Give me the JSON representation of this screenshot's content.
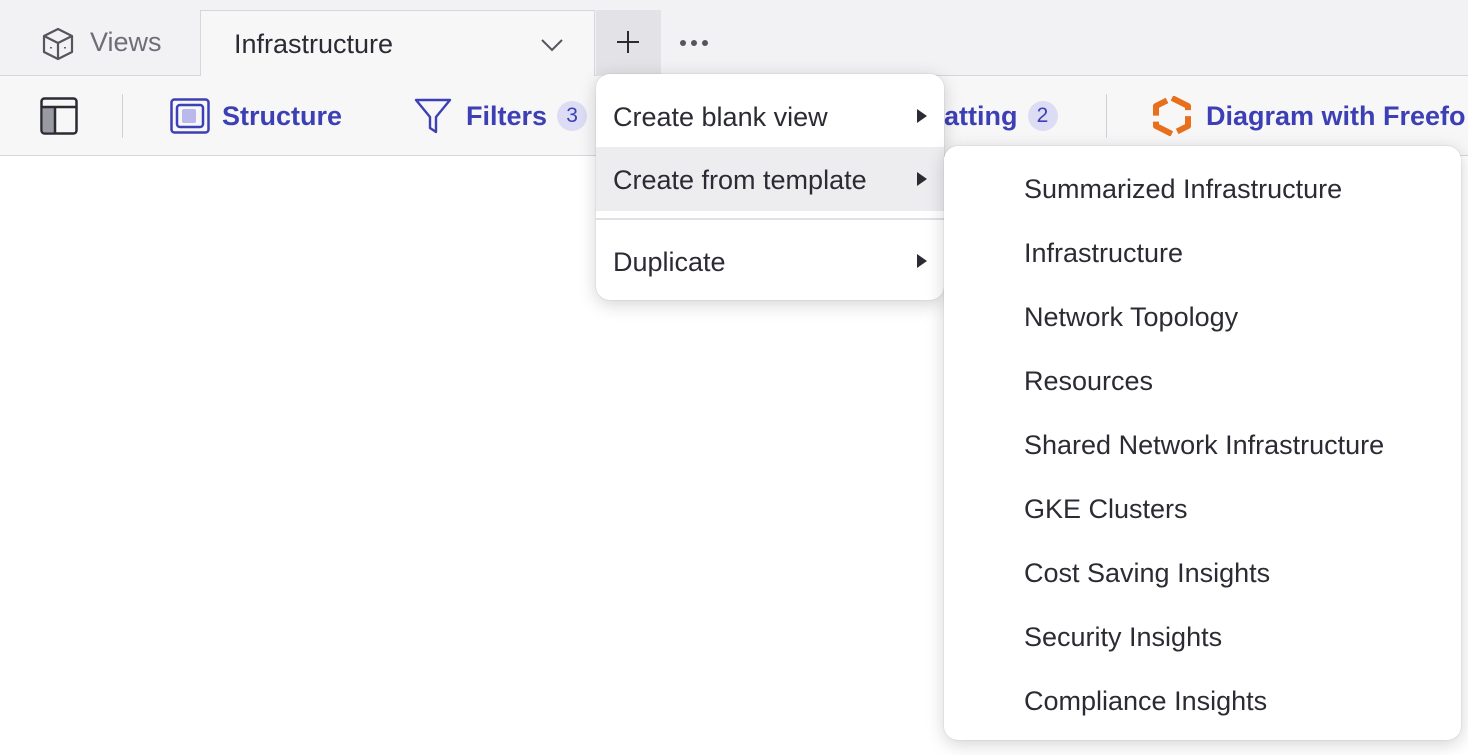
{
  "tabs": {
    "views_label": "Views",
    "active_label": "Infrastructure"
  },
  "toolbar": {
    "structure_label": "Structure",
    "filters_label": "Filters",
    "filters_count": "3",
    "formatting_label": "atting",
    "formatting_count": "2",
    "diagram_label": "Diagram with Freefo"
  },
  "menu": {
    "items": [
      {
        "label": "Create blank view"
      },
      {
        "label": "Create from template"
      },
      {
        "label": "Duplicate"
      }
    ]
  },
  "submenu": {
    "items": [
      {
        "label": "Summarized Infrastructure"
      },
      {
        "label": "Infrastructure"
      },
      {
        "label": "Network Topology"
      },
      {
        "label": "Resources"
      },
      {
        "label": "Shared Network Infrastructure"
      },
      {
        "label": "GKE Clusters"
      },
      {
        "label": "Cost Saving Insights"
      },
      {
        "label": "Security Insights"
      },
      {
        "label": "Compliance Insights"
      }
    ]
  },
  "colors": {
    "accent": "#3d3fb5",
    "badge_bg": "#dcdcf4",
    "diagram_icon": "#e8701c"
  }
}
